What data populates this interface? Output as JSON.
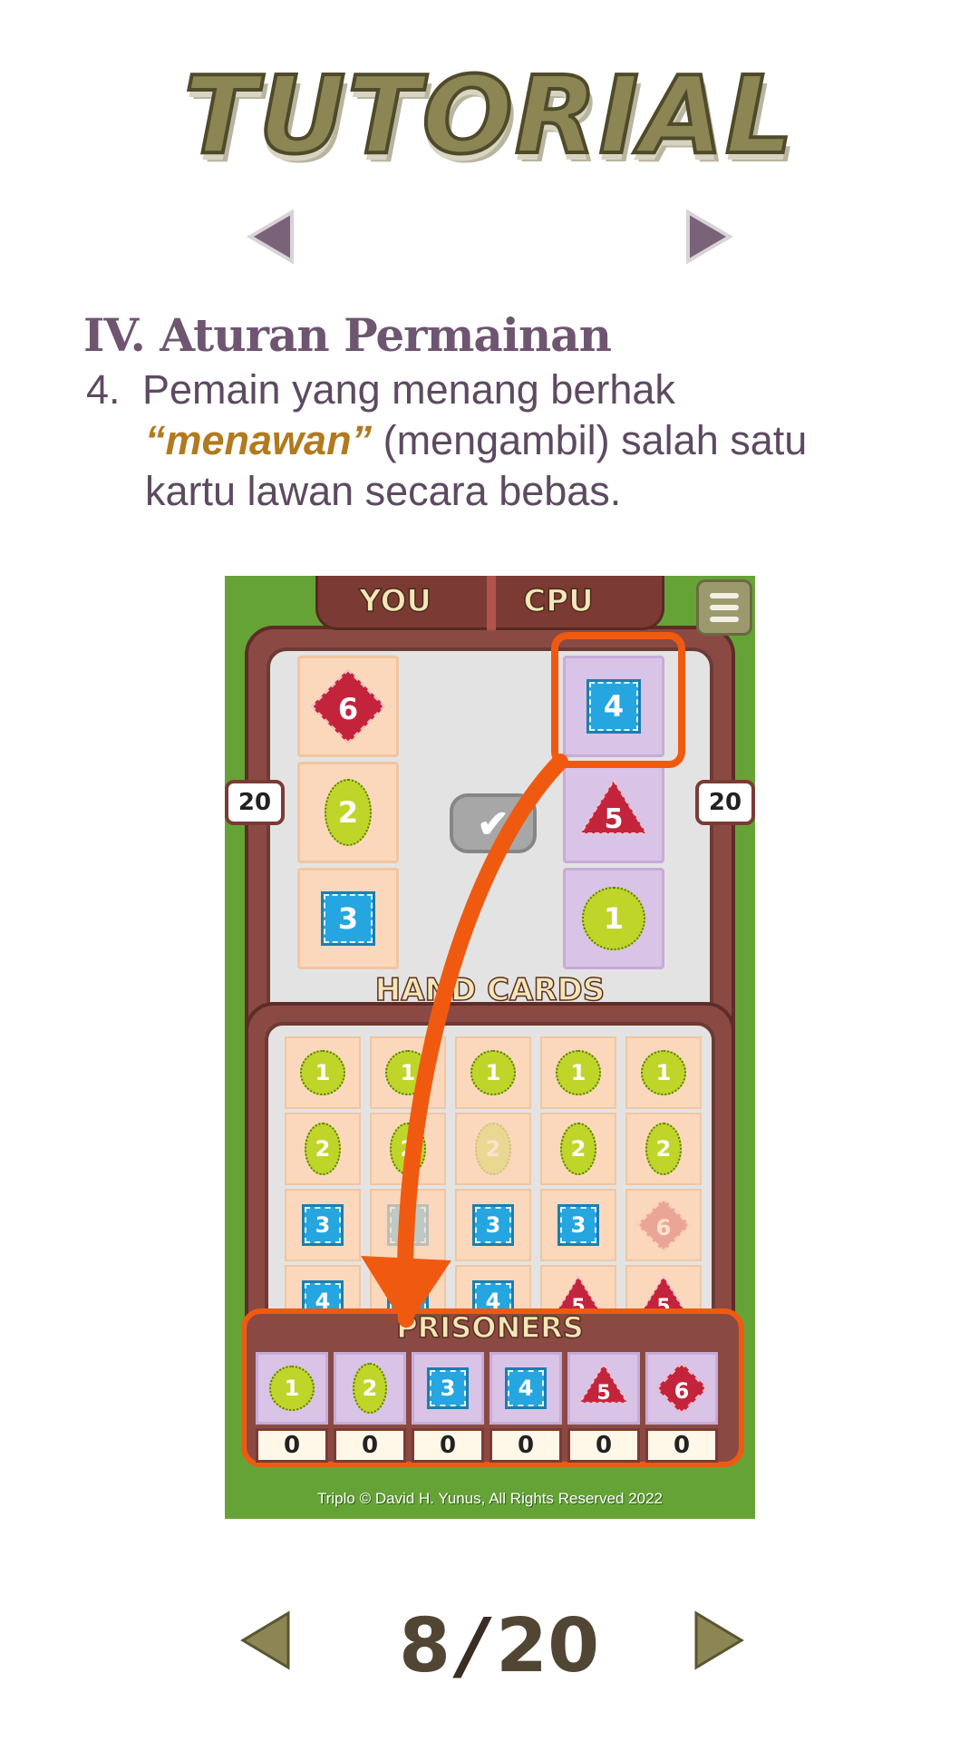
{
  "title": "TUTORIAL",
  "section": {
    "heading": "IV. Aturan Permainan"
  },
  "rule": {
    "number": "4.",
    "line1": "Pemain yang menang berhak",
    "emphasis": "“menawan”",
    "line2_rest": " (mengambil) salah satu",
    "line3": "kartu lawan secara bebas."
  },
  "game": {
    "you_label": "YOU",
    "cpu_label": "CPU",
    "you_score": "20",
    "cpu_score": "20",
    "hand_cards_label": "HAND CARDS",
    "prisoners_label": "PRISONERS",
    "you_cards": [
      "6",
      "2",
      "3"
    ],
    "cpu_cards": [
      "4",
      "5",
      "1"
    ],
    "hand_rows": [
      [
        "1",
        "1",
        "1",
        "1",
        "1"
      ],
      [
        "2",
        "2",
        "2",
        "2",
        "2"
      ],
      [
        "3",
        "3",
        "3",
        "3",
        "6"
      ],
      [
        "4",
        "4",
        "4",
        "5",
        "5"
      ]
    ],
    "prisoners": [
      "1",
      "2",
      "3",
      "4",
      "5",
      "6"
    ],
    "prisoner_counts": [
      "0",
      "0",
      "0",
      "0",
      "0",
      "0"
    ],
    "copyright": "Triplo © David H. Yunus, All Rights Reserved 2022"
  },
  "pager": {
    "current": "8",
    "separator": "/",
    "total": "20"
  },
  "colors": {
    "accent_orange": "#f05a10",
    "frame_brown": "#8a4a43",
    "field_green": "#66a336"
  }
}
